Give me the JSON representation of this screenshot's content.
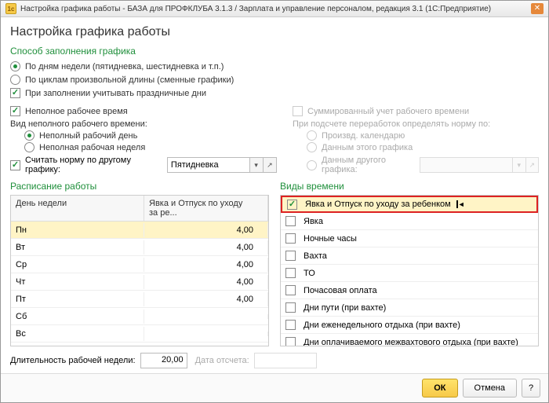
{
  "titlebar": "Настройка графика работы - БАЗА для ПРОФКЛУБА 3.1.3 / Зарплата и управление персоналом, редакция 3.1  (1С:Предприятие)",
  "header": "Настройка графика работы",
  "fill_method": {
    "title": "Способ заполнения графика",
    "by_days": "По дням недели (пятидневка, шестидневка и т.п.)",
    "by_cycles": "По циклам произвольной длины (сменные графики)",
    "holidays": "При заполнении учитывать праздничные дни"
  },
  "parttime": {
    "label": "Неполное рабочее время",
    "kind_label": "Вид неполного рабочего времени:",
    "day": "Неполный рабочий день",
    "week": "Неполная рабочая неделя",
    "by_other": "Считать норму по другому графику:",
    "combo": "Пятидневка"
  },
  "right": {
    "sum": "Суммированный учет рабочего времени",
    "norm_label": "При подсчете переработок определять норму по:",
    "o1": "Произвд. календарю",
    "o2": "Данным этого графика",
    "o3": "Данным другого графика:"
  },
  "schedule": {
    "title": "Расписание работы",
    "col_day": "День недели",
    "col_val": "Явка и Отпуск по уходу за ре...",
    "rows": [
      {
        "d": "Пн",
        "v": "4,00"
      },
      {
        "d": "Вт",
        "v": "4,00"
      },
      {
        "d": "Ср",
        "v": "4,00"
      },
      {
        "d": "Чт",
        "v": "4,00"
      },
      {
        "d": "Пт",
        "v": "4,00"
      },
      {
        "d": "Сб",
        "v": ""
      },
      {
        "d": "Вс",
        "v": ""
      }
    ]
  },
  "time_types": {
    "title": "Виды времени",
    "items": [
      {
        "label": "Явка и Отпуск по уходу за ребенком",
        "checked": true
      },
      {
        "label": "Явка",
        "checked": false
      },
      {
        "label": "Ночные часы",
        "checked": false
      },
      {
        "label": "Вахта",
        "checked": false
      },
      {
        "label": "ТО",
        "checked": false
      },
      {
        "label": "Почасовая оплата",
        "checked": false
      },
      {
        "label": "Дни пути (при вахте)",
        "checked": false
      },
      {
        "label": "Дни еженедельного отдыха (при вахте)",
        "checked": false
      },
      {
        "label": "Дни оплачиваемого межвахтового отдыха (при вахте)",
        "checked": false
      }
    ]
  },
  "bottom": {
    "len_label": "Длительность рабочей недели:",
    "len_value": "20,00",
    "date_label": "Дата отсчета:"
  },
  "footer": {
    "ok": "ОК",
    "cancel": "Отмена",
    "help": "?"
  }
}
